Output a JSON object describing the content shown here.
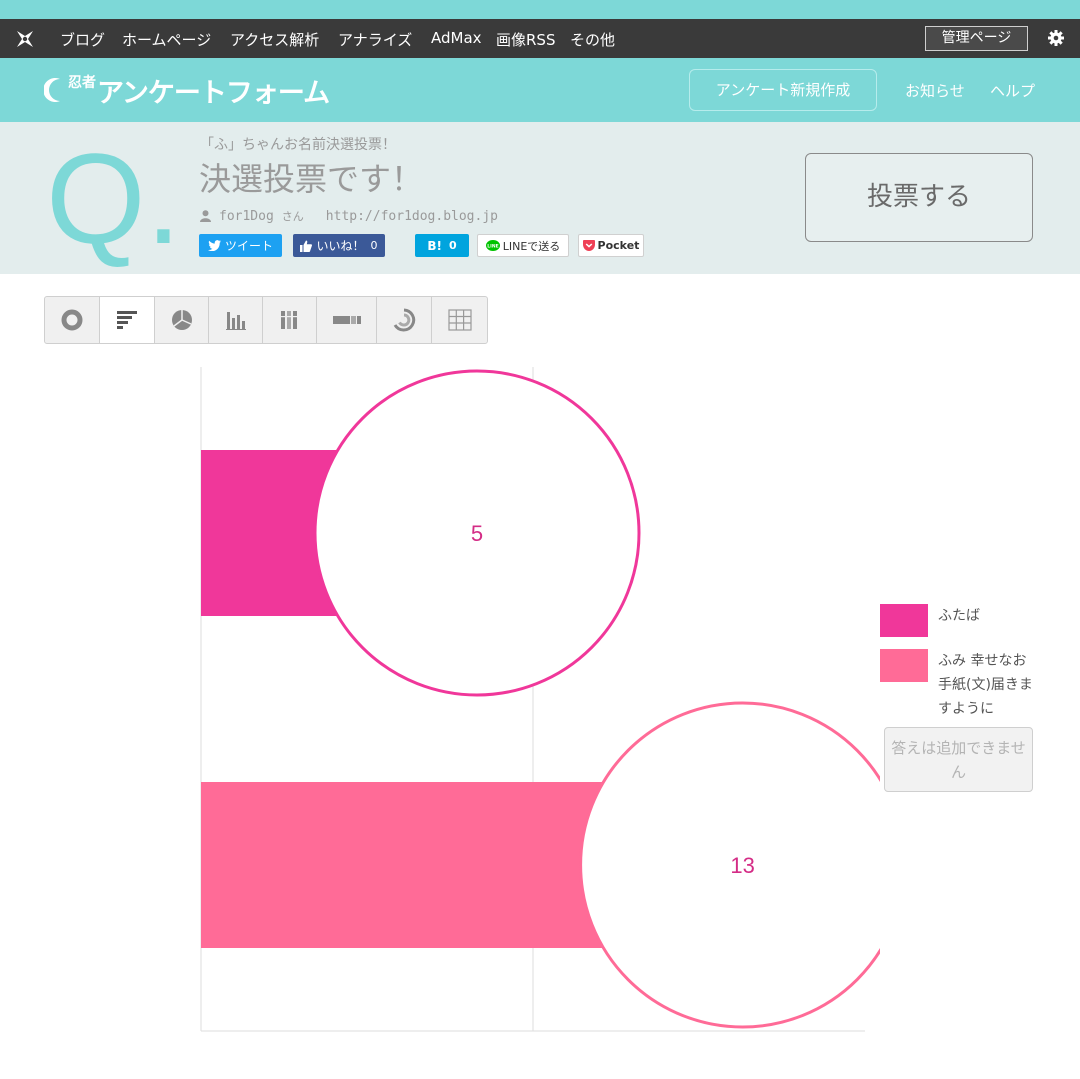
{
  "navbar": {
    "items": [
      "ブログ",
      "ホームページ",
      "アクセス解析",
      "アナライズ",
      "AdMax",
      "画像RSS",
      "その他"
    ],
    "admin_label": "管理ページ"
  },
  "header": {
    "brand_small": "忍者",
    "brand_main": "アンケートフォーム",
    "new_survey_label": "アンケート新規作成",
    "news_label": "お知らせ",
    "help_label": "ヘルプ"
  },
  "question": {
    "q_mark": "Q.",
    "subtitle": "「ふ」ちゃんお名前決選投票！",
    "title": "決選投票です！",
    "author": "for1Dog",
    "honorific": "さん",
    "url": "http://for1dog.blog.jp",
    "vote_label": "投票する"
  },
  "share": {
    "tweet": "ツイート",
    "like": "いいね！",
    "like_count": "0",
    "hatena": "B!",
    "hatena_count": "0",
    "line": "LINEで送る",
    "pocket": "Pocket"
  },
  "toolbar": {
    "buttons": [
      "donut-chart-icon",
      "horizontal-bar-chart-icon",
      "pie-chart-icon",
      "column-chart-icon",
      "stacked-column-chart-icon",
      "stacked-bar-icon",
      "radial-chart-icon",
      "table-icon"
    ],
    "active": "horizontal-bar-chart-icon"
  },
  "legend": {
    "items": [
      {
        "label": "ふたば",
        "color": "#f0379a"
      },
      {
        "label": "ふみ 幸せなお手紙(文)届きますように",
        "color": "#ff6b97"
      }
    ]
  },
  "add_answer_label": "答えは追加できません",
  "chart_data": {
    "type": "bar",
    "orientation": "horizontal",
    "categories": [
      "ふたば",
      "ふみ 幸せなお手紙(文)届きますように"
    ],
    "values": [
      5,
      13
    ],
    "colors": [
      "#f0379a",
      "#ff6b97"
    ],
    "xlim": [
      0,
      20
    ],
    "grid": true,
    "legend_position": "right"
  }
}
